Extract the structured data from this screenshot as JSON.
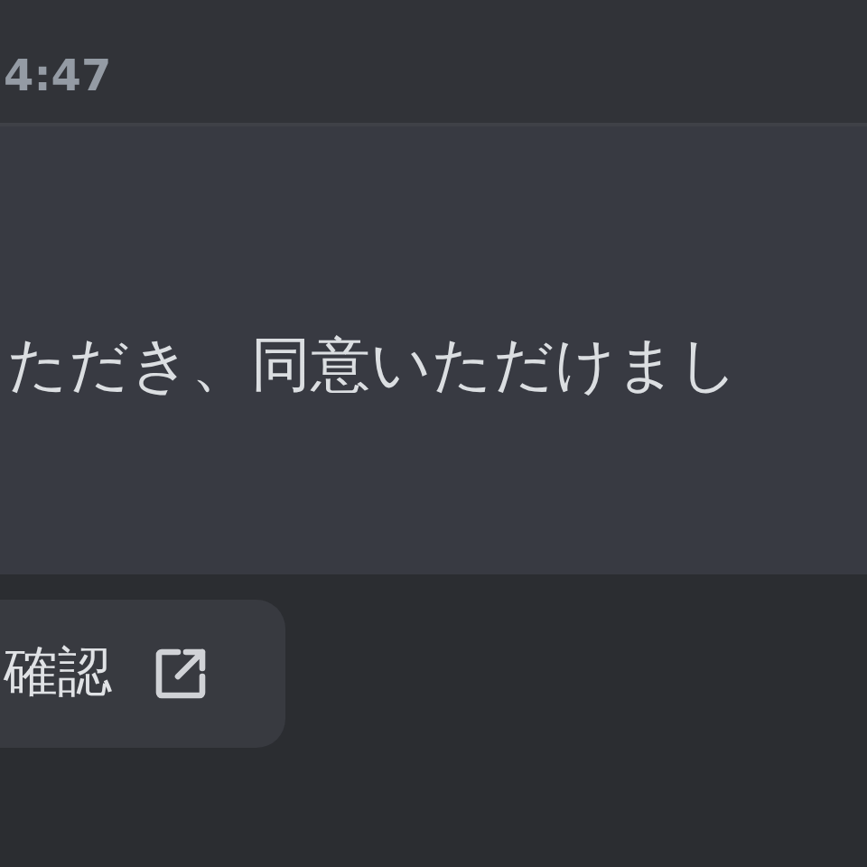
{
  "timestamp": "4:47",
  "message": {
    "text": "ただき、同意いただけまし"
  },
  "button": {
    "label": "確認"
  }
}
